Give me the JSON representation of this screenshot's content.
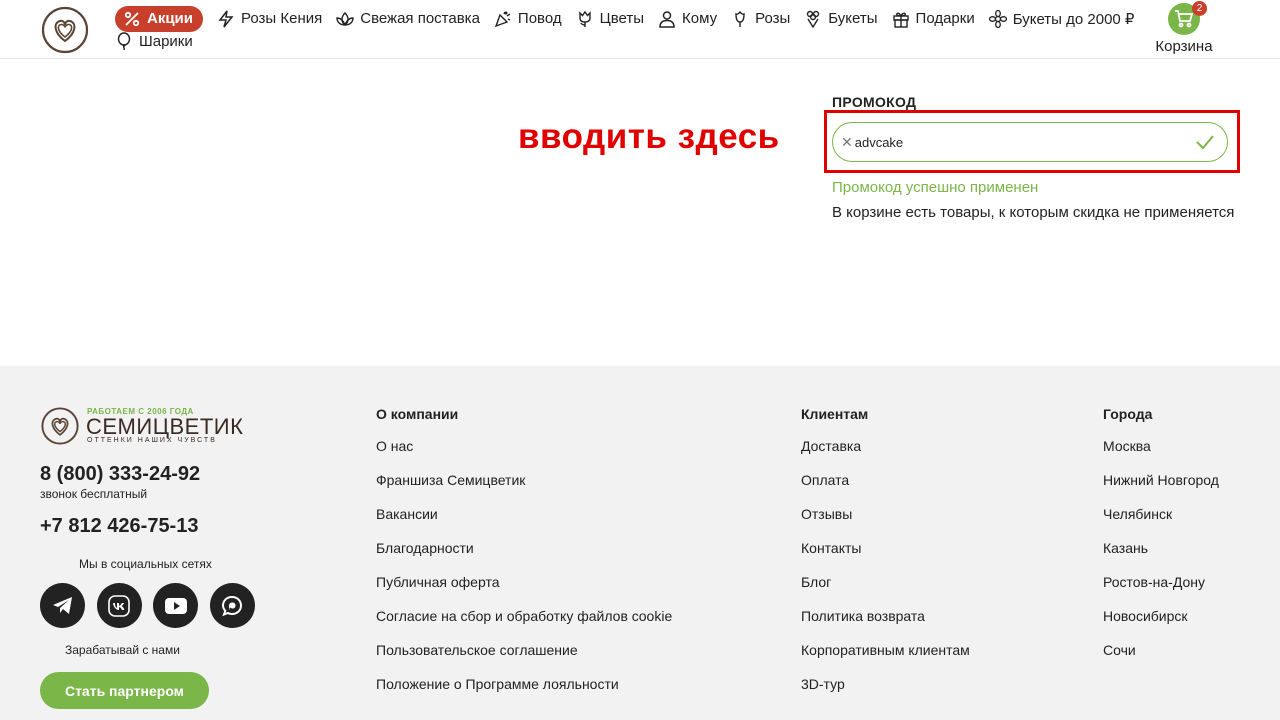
{
  "header": {
    "nav_row1": [
      {
        "label": "Акции",
        "icon": "percent-icon"
      },
      {
        "label": "Розы Кения",
        "icon": "lightning-icon"
      },
      {
        "label": "Свежая поставка",
        "icon": "lotus-icon"
      },
      {
        "label": "Повод",
        "icon": "party-popper-icon"
      },
      {
        "label": "Цветы",
        "icon": "tulip-icon"
      },
      {
        "label": "Кому",
        "icon": "person-icon"
      },
      {
        "label": "Розы",
        "icon": "rose-icon"
      },
      {
        "label": "Букеты",
        "icon": "bouquet-icon"
      },
      {
        "label": "Подарки",
        "icon": "gift-icon"
      },
      {
        "label": "Букеты до 2000 ₽",
        "icon": "flower-icon"
      }
    ],
    "nav_row2": [
      {
        "label": "Шарики",
        "icon": "balloon-icon"
      }
    ],
    "cart": {
      "label": "Корзина",
      "count": "2"
    }
  },
  "annotation": "вводить здесь",
  "promo": {
    "title": "ПРОМОКОД",
    "value": "advcake",
    "success": "Промокод успешно применен",
    "note": "В корзине есть товары, к которым скидка не применяется"
  },
  "footer": {
    "logo": {
      "tagline": "РАБОТАЕМ С 2006 ГОДА",
      "name": "СЕМИЦВЕТИК",
      "subtitle": "ОТТЕНКИ НАШИХ ЧУВСТВ"
    },
    "phone1": "8 (800) 333-24-92",
    "phone1_note": "звонок бесплатный",
    "phone2": "+7 812 426-75-13",
    "social_label": "Мы в социальных сетях",
    "socials": [
      "telegram-icon",
      "vk-icon",
      "youtube-icon",
      "chat-icon"
    ],
    "earn_label": "Зарабатывай с нами",
    "partner_button": "Стать партнером",
    "columns": [
      {
        "title": "О компании",
        "items": [
          "О нас",
          "Франшиза Семицветик",
          "Вакансии",
          "Благодарности",
          "Публичная оферта",
          "Согласие на сбор и обработку файлов cookie",
          "Пользовательское соглашение",
          "Положение о Программе лояльности"
        ]
      },
      {
        "title": "Клиентам",
        "items": [
          "Доставка",
          "Оплата",
          "Отзывы",
          "Контакты",
          "Блог",
          "Политика возврата",
          "Корпоративным клиентам",
          "3D-тур"
        ]
      },
      {
        "title": "Города",
        "items": [
          "Москва",
          "Нижний Новгород",
          "Челябинск",
          "Казань",
          "Ростов-на-Дону",
          "Новосибирск",
          "Сочи"
        ]
      }
    ]
  },
  "colors": {
    "accent_green": "#7ab648",
    "promo_red": "#c8402c",
    "annotation_red": "#e00000",
    "footer_bg": "#f2f2f2"
  }
}
